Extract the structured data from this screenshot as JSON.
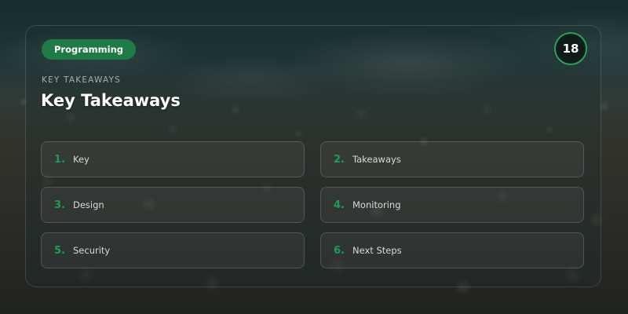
{
  "slide": {
    "tag": "Programming",
    "page_number": "18",
    "eyebrow": "KEY TAKEAWAYS",
    "title": "Key Takeaways"
  },
  "items": [
    {
      "number": "1.",
      "label": "Key"
    },
    {
      "number": "2.",
      "label": "Takeaways"
    },
    {
      "number": "3.",
      "label": "Design"
    },
    {
      "number": "4.",
      "label": "Monitoring"
    },
    {
      "number": "5.",
      "label": "Security"
    },
    {
      "number": "6.",
      "label": "Next Steps"
    }
  ],
  "colors": {
    "accent": "#1f9d55",
    "tag_background": "#1f7a45",
    "badge_border": "#2aa15a"
  }
}
